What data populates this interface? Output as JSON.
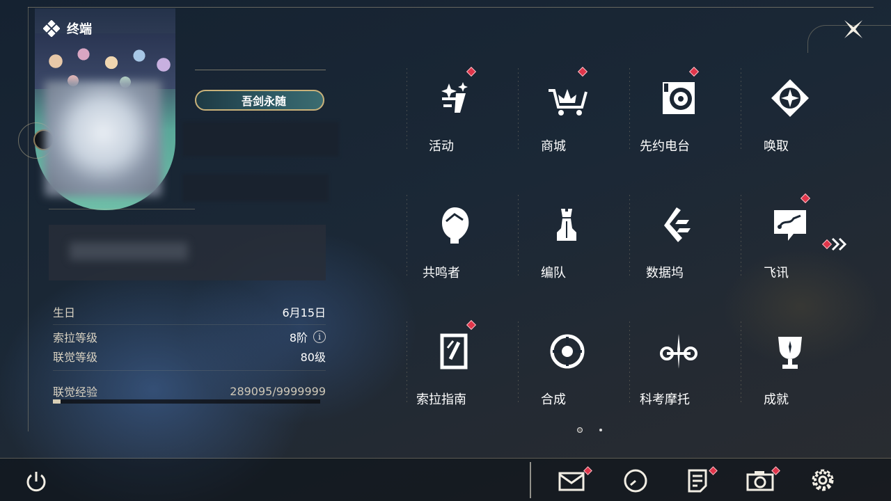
{
  "header": {
    "title": "终端",
    "close_icon": "close-x-icon"
  },
  "profile": {
    "title_badge": "吾剑永随",
    "stats": [
      {
        "label": "生日",
        "value": "6月15日"
      },
      {
        "label": "索拉等级",
        "value": "8阶"
      },
      {
        "label": "联觉等级",
        "value": "80级"
      },
      {
        "label": "联觉经验",
        "value": "289095/9999999"
      }
    ],
    "exp_progress": 0.029
  },
  "menu": {
    "items": [
      {
        "label": "活动",
        "icon": "activity-icon",
        "badge": true
      },
      {
        "label": "商城",
        "icon": "shop-cart-icon",
        "badge": true
      },
      {
        "label": "先约电台",
        "icon": "radio-icon",
        "badge": true
      },
      {
        "label": "唤取",
        "icon": "summon-compass-icon",
        "badge": false
      },
      {
        "label": "共鸣者",
        "icon": "resonator-icon",
        "badge": false
      },
      {
        "label": "编队",
        "icon": "team-chess-icon",
        "badge": false
      },
      {
        "label": "数据坞",
        "icon": "data-bank-icon",
        "badge": false
      },
      {
        "label": "飞讯",
        "icon": "message-chat-icon",
        "badge": true
      },
      {
        "label": "索拉指南",
        "icon": "guide-book-icon",
        "badge": true
      },
      {
        "label": "合成",
        "icon": "synthesis-icon",
        "badge": false
      },
      {
        "label": "科考摩托",
        "icon": "motorcycle-icon",
        "badge": false
      },
      {
        "label": "成就",
        "icon": "trophy-icon",
        "badge": false
      }
    ],
    "more_badge": true
  },
  "bottom": {
    "power_icon": "power-icon",
    "icons": [
      "mail-icon",
      "clock-icon",
      "notes-icon",
      "camera-icon",
      "settings-gear-icon"
    ]
  },
  "colors": {
    "badge": "#e0354a",
    "accent": "#c9b27a"
  }
}
